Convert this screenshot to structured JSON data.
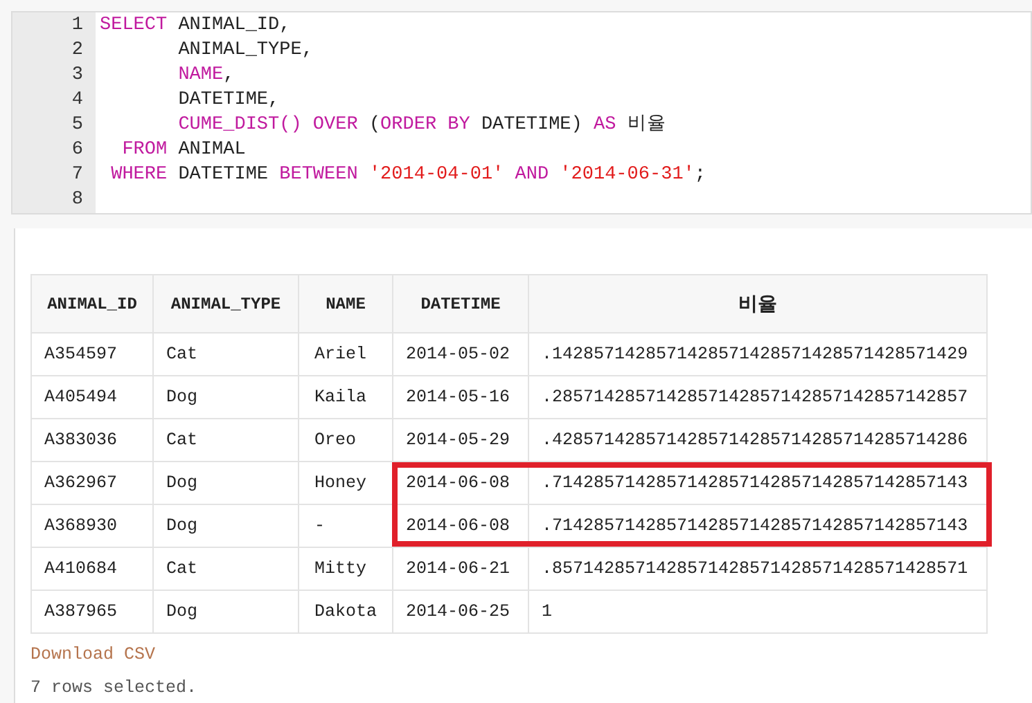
{
  "editor": {
    "lines": [
      {
        "number": "1",
        "tokens": [
          {
            "kind": "kw",
            "text": "SELECT"
          },
          {
            "kind": "plain",
            "text": " ANIMAL_ID,"
          }
        ]
      },
      {
        "number": "2",
        "tokens": [
          {
            "kind": "plain",
            "text": "       ANIMAL_TYPE,"
          }
        ]
      },
      {
        "number": "3",
        "tokens": [
          {
            "kind": "kw",
            "text": "       NAME"
          },
          {
            "kind": "plain",
            "text": ","
          }
        ]
      },
      {
        "number": "4",
        "tokens": [
          {
            "kind": "plain",
            "text": "       DATETIME,"
          }
        ]
      },
      {
        "number": "5",
        "tokens": [
          {
            "kind": "kw",
            "text": "       CUME_DIST() OVER"
          },
          {
            "kind": "plain",
            "text": " ("
          },
          {
            "kind": "kw",
            "text": "ORDER BY"
          },
          {
            "kind": "plain",
            "text": " DATETIME) "
          },
          {
            "kind": "kw",
            "text": "AS"
          },
          {
            "kind": "plain",
            "text": " 비율"
          }
        ]
      },
      {
        "number": "6",
        "tokens": [
          {
            "kind": "kw",
            "text": "  FROM"
          },
          {
            "kind": "plain",
            "text": " ANIMAL"
          }
        ]
      },
      {
        "number": "7",
        "tokens": [
          {
            "kind": "kw",
            "text": " WHERE"
          },
          {
            "kind": "plain",
            "text": " DATETIME "
          },
          {
            "kind": "kw",
            "text": "BETWEEN"
          },
          {
            "kind": "str",
            "text": " '2014-04-01'"
          },
          {
            "kind": "kw",
            "text": " AND"
          },
          {
            "kind": "str",
            "text": " '2014-06-31'"
          },
          {
            "kind": "plain",
            "text": ";"
          }
        ]
      },
      {
        "number": "8"
      }
    ]
  },
  "results": {
    "columns": [
      "ANIMAL_ID",
      "ANIMAL_TYPE",
      "NAME",
      "DATETIME",
      "비율"
    ],
    "rows": [
      {
        "cells": [
          "A354597",
          "Cat",
          "Ariel",
          "2014-05-02",
          ".1428571428571428571428571428571428571429"
        ],
        "highlighted": false
      },
      {
        "cells": [
          "A405494",
          "Dog",
          "Kaila",
          "2014-05-16",
          ".2857142857142857142857142857142857142857"
        ],
        "highlighted": false
      },
      {
        "cells": [
          "A383036",
          "Cat",
          "Oreo",
          "2014-05-29",
          ".4285714285714285714285714285714285714286"
        ],
        "highlighted": false
      },
      {
        "cells": [
          "A362967",
          "Dog",
          "Honey",
          "2014-06-08",
          ".7142857142857142857142857142857142857143"
        ],
        "highlighted": true
      },
      {
        "cells": [
          "A368930",
          "Dog",
          "-",
          "2014-06-08",
          ".7142857142857142857142857142857142857143"
        ],
        "highlighted": true
      },
      {
        "cells": [
          "A410684",
          "Cat",
          "Mitty",
          "2014-06-21",
          ".8571428571428571428571428571428571428571"
        ],
        "highlighted": false
      },
      {
        "cells": [
          "A387965",
          "Dog",
          "Dakota",
          "2014-06-25",
          "1"
        ],
        "highlighted": false
      }
    ],
    "download_link": "Download CSV",
    "status": "7 rows selected."
  }
}
